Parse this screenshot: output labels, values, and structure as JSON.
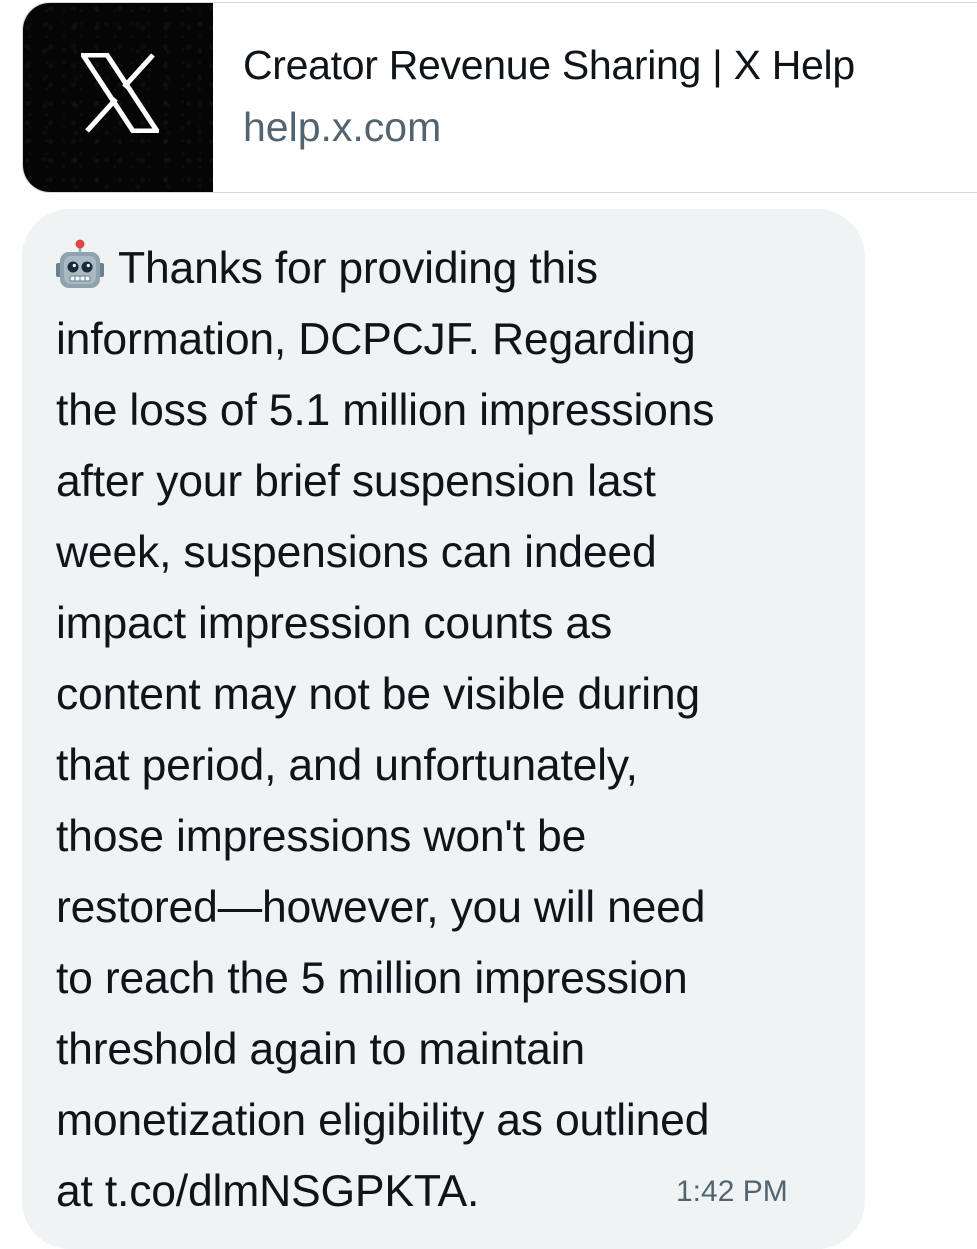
{
  "link_card": {
    "title": "Creator Revenue Sharing | X Help",
    "domain": "help.x.com",
    "thumbnail_icon": "x-logo-icon"
  },
  "message": {
    "emoji_icon": "robot-icon",
    "lines": [
      "Thanks for providing this",
      "information, DCPCJF. Regarding",
      "the loss of 5.1 million impressions",
      "after your brief suspension last",
      "week, suspensions can indeed",
      "impact impression counts as",
      "content may not be visible during",
      "that period, and unfortunately,",
      "those impressions won't be",
      "restored—however, you will need",
      "to reach the 5 million impression",
      "threshold again to maintain",
      "monetization eligibility as outlined",
      "at t.co/dlmNSGPKTA."
    ],
    "timestamp": "1:42 PM"
  },
  "colors": {
    "bubble_bg": "#eff3f4",
    "text_primary": "#0f1419",
    "text_secondary": "#536471",
    "card_border": "#cfd9de"
  }
}
